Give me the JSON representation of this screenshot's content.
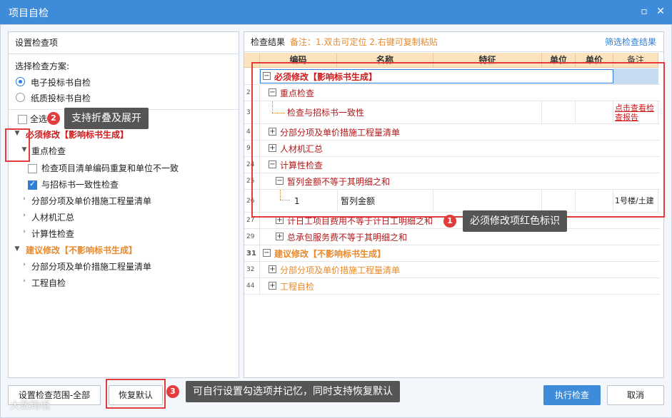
{
  "window": {
    "title": "项目自检"
  },
  "left": {
    "header": "设置检查项",
    "scheme_label": "选择检查方案:",
    "schemes": [
      {
        "label": "电子投标书自检",
        "selected": true
      },
      {
        "label": "纸质投标书自检",
        "selected": false
      }
    ],
    "select_all": "全选",
    "tree": {
      "must": "必须修改【影响标书生成】",
      "key_check": "重点检查",
      "key_items": [
        {
          "label": "检查项目清单编码重复和单位不一致",
          "checked": false
        },
        {
          "label": "与招标书一致性检查",
          "checked": true
        }
      ],
      "must_children": [
        "分部分项及单价措施工程量清单",
        "人材机汇总",
        "计算性检查"
      ],
      "suggest": "建议修改【不影响标书生成】",
      "suggest_children": [
        "分部分项及单价措施工程量清单",
        "工程自检"
      ]
    }
  },
  "right": {
    "header": "检查结果",
    "note": "备注：1.双击可定位 2.右键可复制粘贴",
    "filter_link": "筛选检查结果",
    "columns": [
      "编码",
      "名称",
      "特征",
      "单位",
      "单价",
      "备注"
    ],
    "rows": [
      {
        "num": "",
        "text": "必须修改【影响标书生成】"
      },
      {
        "num": "2",
        "text": "重点检查"
      },
      {
        "num": "3",
        "text": "检查与招标书一致性",
        "remark": "点击查看检查报告"
      },
      {
        "num": "4",
        "text": "分部分项及单价措施工程量清单"
      },
      {
        "num": "9",
        "text": "人材机汇总"
      },
      {
        "num": "24",
        "text": "计算性检查"
      },
      {
        "num": "25",
        "text": "暂列金额不等于其明细之和"
      },
      {
        "num": "26",
        "code": "1",
        "name": "暂列金额",
        "remark": "1号楼/土建"
      },
      {
        "num": "27",
        "text": "计日工项目费用不等于计日工明细之和"
      },
      {
        "num": "29",
        "text": "总承包服务费不等于其明细之和"
      },
      {
        "num": "31",
        "text": "建议修改【不影响标书生成】"
      },
      {
        "num": "32",
        "text": "分部分项及单价措施工程量清单"
      },
      {
        "num": "44",
        "text": "工程自检"
      }
    ]
  },
  "annotations": {
    "a1": {
      "num": "1",
      "text": "必须修改项红色标识"
    },
    "a2": {
      "num": "2",
      "text": "支持折叠及展开"
    },
    "a3": {
      "num": "3",
      "text": "可自行设置勾选项并记忆，同时支持恢复默认"
    }
  },
  "buttons": {
    "set_scope": "设置检查范围-全部",
    "restore": "恢复默认",
    "run": "执行检查",
    "cancel": "取消"
  },
  "watermark": "大数跨境",
  "colors": {
    "accent": "#3d8bd9",
    "must": "#d0191b",
    "suggest": "#e8892a",
    "annotation": "#e23c3c"
  }
}
